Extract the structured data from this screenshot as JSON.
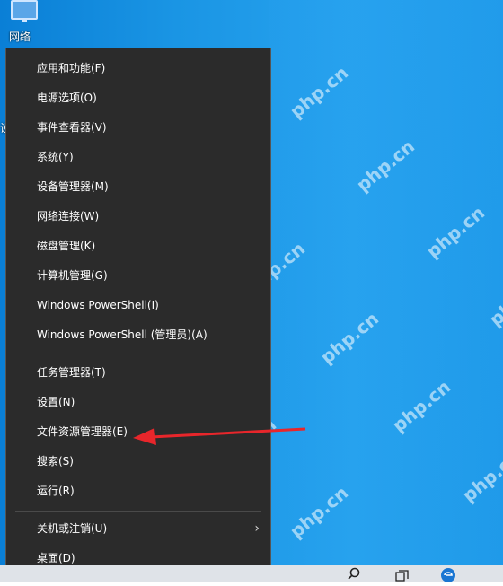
{
  "desktop": {
    "icon_label": "网络",
    "partial_label": "设"
  },
  "menu": {
    "items": [
      {
        "label": "应用和功能(F)"
      },
      {
        "label": "电源选项(O)"
      },
      {
        "label": "事件查看器(V)"
      },
      {
        "label": "系统(Y)"
      },
      {
        "label": "设备管理器(M)"
      },
      {
        "label": "网络连接(W)"
      },
      {
        "label": "磁盘管理(K)"
      },
      {
        "label": "计算机管理(G)"
      },
      {
        "label": "Windows PowerShell(I)"
      },
      {
        "label": "Windows PowerShell (管理员)(A)"
      },
      {
        "label": "任务管理器(T)"
      },
      {
        "label": "设置(N)"
      },
      {
        "label": "文件资源管理器(E)"
      },
      {
        "label": "搜索(S)"
      },
      {
        "label": "运行(R)"
      },
      {
        "label": "关机或注销(U)",
        "submenu_arrow": "›"
      },
      {
        "label": "桌面(D)"
      }
    ]
  },
  "watermark": {
    "text": "php.cn"
  },
  "annotation": {
    "color": "#e8262b"
  },
  "colors": {
    "menu_bg": "#2b2b2b",
    "desktop_blue": "#1a95e4",
    "taskbar": "#dfe3e8"
  }
}
